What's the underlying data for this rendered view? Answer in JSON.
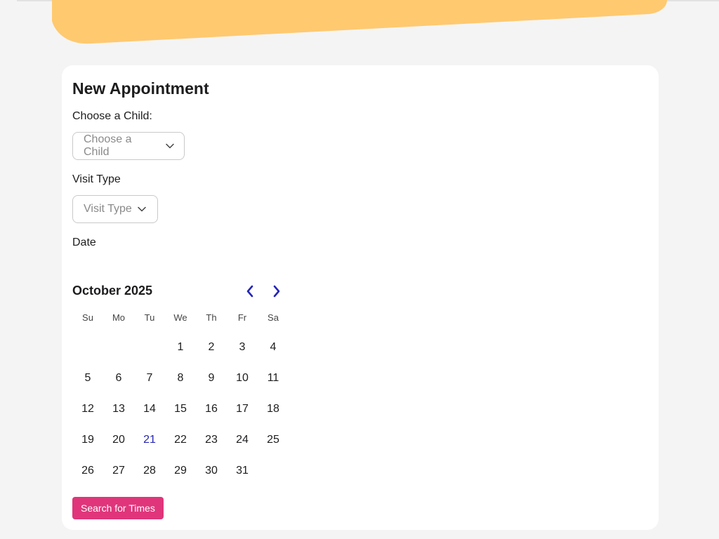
{
  "form": {
    "title": "New Appointment",
    "child_label": "Choose a Child:",
    "child_placeholder": "Choose a Child",
    "visit_label": "Visit Type",
    "visit_placeholder": "Visit Type",
    "date_label": "Date",
    "search_label": "Search for Times"
  },
  "calendar": {
    "month_label": "October 2025",
    "weekdays": [
      "Su",
      "Mo",
      "Tu",
      "We",
      "Th",
      "Fr",
      "Sa"
    ],
    "weeks": [
      [
        "",
        "",
        "",
        "1",
        "2",
        "3",
        "4"
      ],
      [
        "5",
        "6",
        "7",
        "8",
        "9",
        "10",
        "11"
      ],
      [
        "12",
        "13",
        "14",
        "15",
        "16",
        "17",
        "18"
      ],
      [
        "19",
        "20",
        "21",
        "22",
        "23",
        "24",
        "25"
      ],
      [
        "26",
        "27",
        "28",
        "29",
        "30",
        "31",
        ""
      ]
    ],
    "today": "21"
  },
  "icons": {
    "prev": "chevron-left-icon",
    "next": "chevron-right-icon",
    "dropdown": "chevron-down-icon"
  },
  "colors": {
    "banner": "#ffc96f",
    "accent_button": "#e0357a",
    "nav_chevron": "#2525b8",
    "today_text": "#2525b8",
    "card_bg": "#ffffff",
    "page_bg": "#f4f4f4"
  }
}
